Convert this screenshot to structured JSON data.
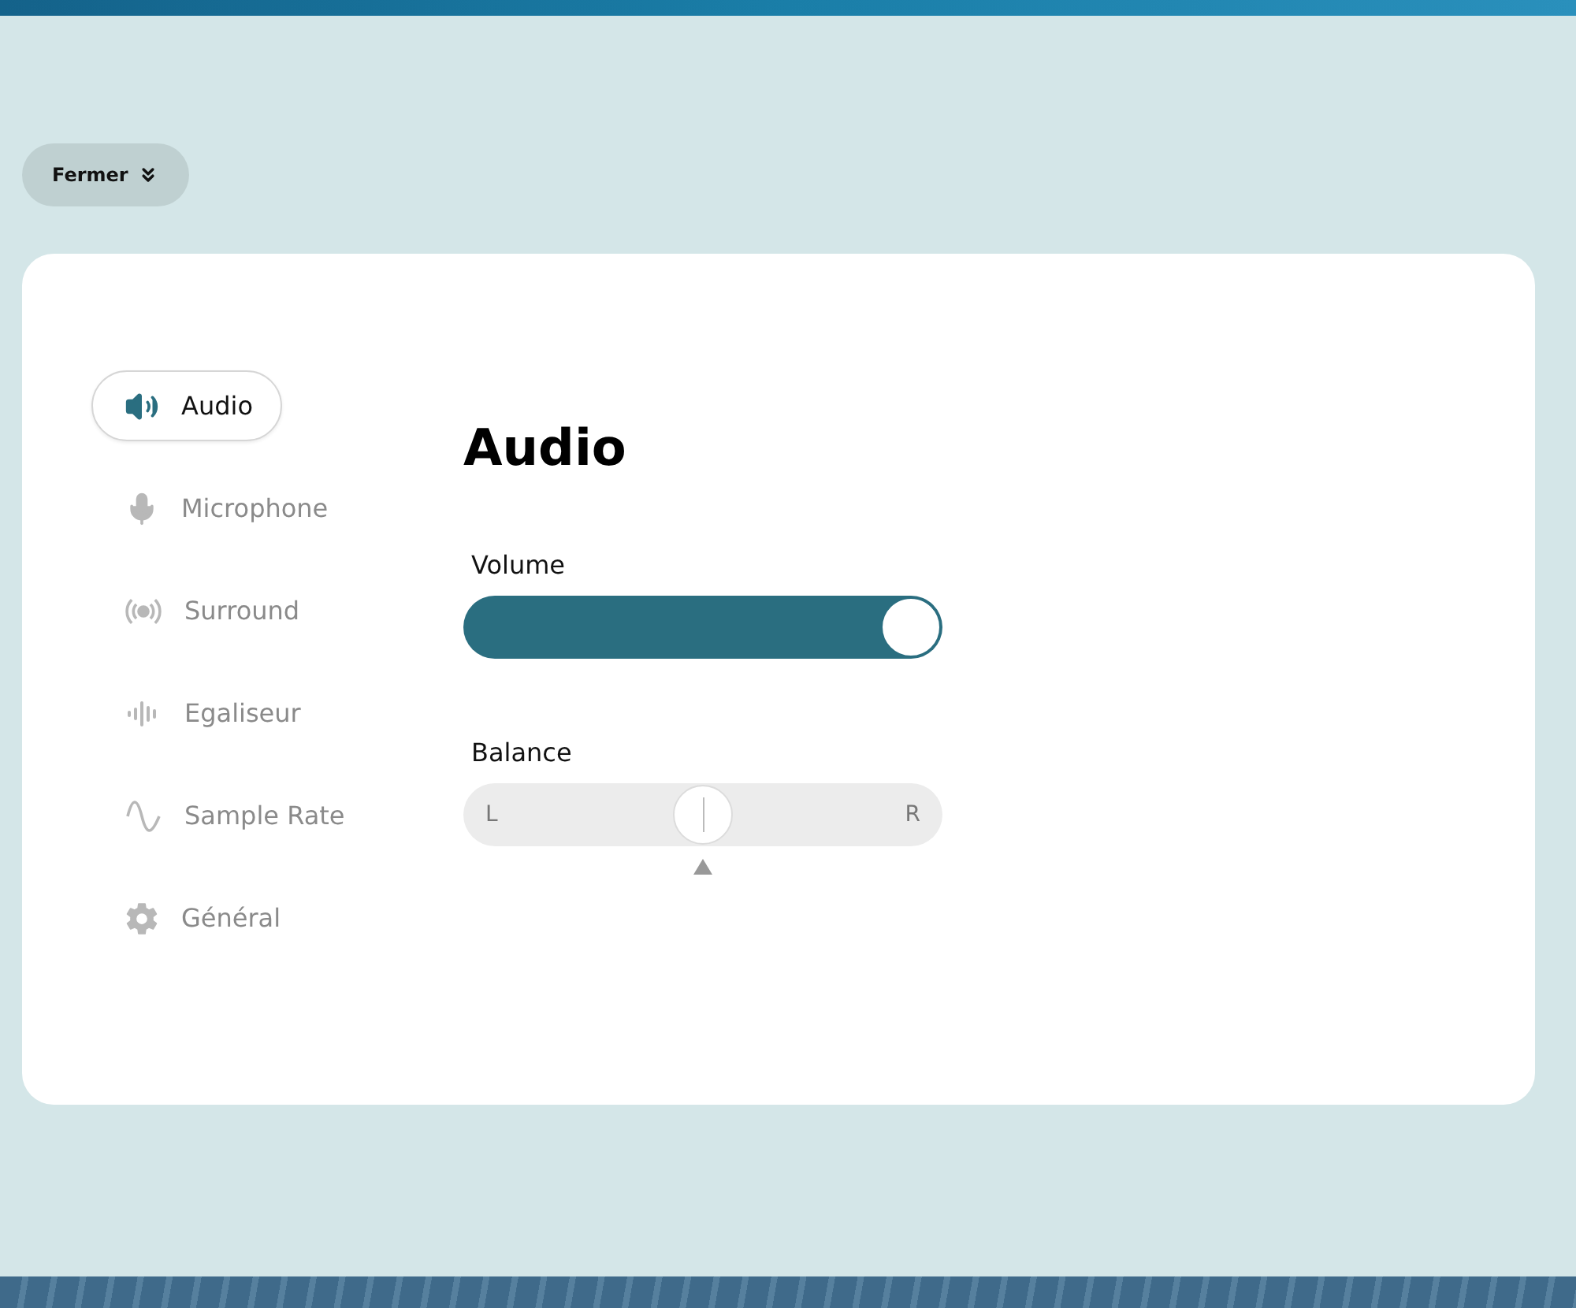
{
  "close_button": {
    "label": "Fermer"
  },
  "sidebar": {
    "items": [
      {
        "label": "Audio",
        "kind": "speaker",
        "selected": true
      },
      {
        "label": "Microphone",
        "kind": "mic",
        "selected": false
      },
      {
        "label": "Surround",
        "kind": "broadcast",
        "selected": false
      },
      {
        "label": "Egaliseur",
        "kind": "bars",
        "selected": false
      },
      {
        "label": "Sample Rate",
        "kind": "wave",
        "selected": false
      },
      {
        "label": "Général",
        "kind": "gear",
        "selected": false
      }
    ]
  },
  "panel": {
    "title": "Audio",
    "volume": {
      "label": "Volume",
      "level": 1.0
    },
    "balance": {
      "label": "Balance",
      "left": "L",
      "right": "R",
      "level": 0.5
    }
  }
}
